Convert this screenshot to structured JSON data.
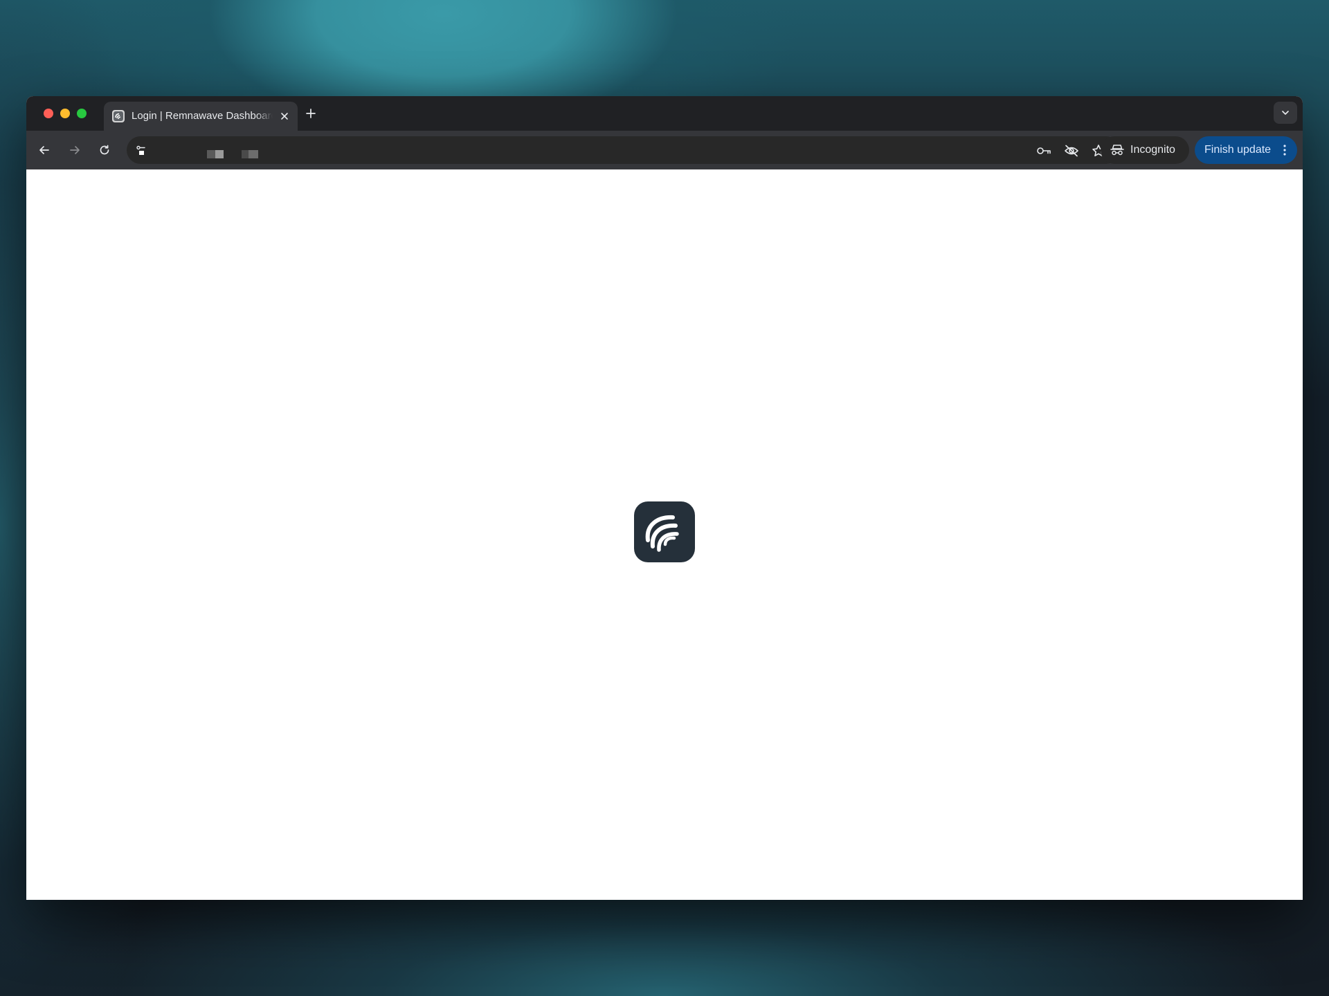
{
  "browser": {
    "tab": {
      "title": "Login | Remnawave Dashboard",
      "favicon": "remnawave-favicon-icon"
    },
    "icons": {
      "close_tab": "close-icon",
      "new_tab": "plus-icon",
      "tab_list": "chevron-down-icon",
      "back": "arrow-left-icon",
      "forward": "arrow-right-icon",
      "reload": "reload-icon",
      "site_info": "tune-icon",
      "password": "key-icon",
      "tracking": "eye-off-icon",
      "bookmark": "star-icon",
      "incognito": "incognito-icon",
      "menu": "more-vert-icon"
    },
    "address_bar": {
      "url": ""
    },
    "incognito_label": "Incognito",
    "update_label": "Finish update"
  },
  "page": {
    "logo": "remnawave-logo-icon"
  },
  "colors": {
    "tab_strip": "#202124",
    "toolbar": "#35363a",
    "update_button": "#0b4c8c",
    "logo_bg": "#25303a"
  }
}
